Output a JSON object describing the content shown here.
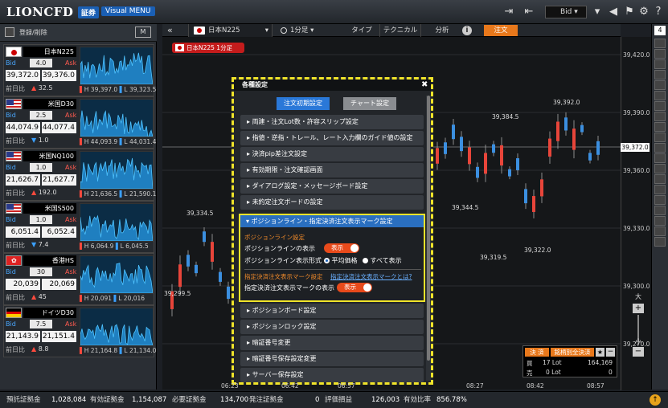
{
  "header": {
    "logo": "LIONCFD",
    "logo_badge": "証券",
    "visual_menu": "Visual MENU",
    "bid_select": "Bid"
  },
  "sidebar": {
    "register_label": "登録/削除",
    "m_label": "M",
    "cards": [
      {
        "name": "日本N225",
        "spread": "4.0",
        "bid": "39,372.0",
        "ask": "39,376.0",
        "change": "32.5",
        "dir": "up",
        "high": "H 39,397.0",
        "low": "L 39,323.5",
        "flag": "jp"
      },
      {
        "name": "米国D30",
        "spread": "2.5",
        "bid": "44,074.9",
        "ask": "44,077.4",
        "change": "1.0",
        "dir": "dn",
        "high": "H 44,093.9",
        "low": "L 44,031.4",
        "flag": "us"
      },
      {
        "name": "米国NQ100",
        "spread": "1.0",
        "bid": "21,626.7",
        "ask": "21,627.7",
        "change": "192.0",
        "dir": "up",
        "high": "H 21,636.5",
        "low": "L 21,590.1",
        "flag": "us"
      },
      {
        "name": "米国S500",
        "spread": "1.0",
        "bid": "6,051.4",
        "ask": "6,052.4",
        "change": "7.4",
        "dir": "dn",
        "high": "H 6,064.9",
        "low": "L 6,045.5",
        "flag": "us"
      },
      {
        "name": "香港HS",
        "spread": "30",
        "bid": "20,039",
        "ask": "20,069",
        "change": "45",
        "dir": "up",
        "high": "H 20,091",
        "low": "L 20,016",
        "flag": "hk"
      },
      {
        "name": "ドイツD30",
        "spread": "7.5",
        "bid": "21,143.9",
        "ask": "21,151.4",
        "change": "8.8",
        "dir": "up",
        "high": "H 21,164.8",
        "low": "L 21,134.0",
        "flag": "de"
      }
    ],
    "bid_label": "Bid",
    "ask_label": "Ask",
    "prev_label": "前日比"
  },
  "toolbar": {
    "symbol": "日本N225",
    "interval": "1分足",
    "type": "タイプ",
    "technical": "テクニカル",
    "analysis": "分析",
    "order": "注文"
  },
  "chart": {
    "symbol_tag": "日本N225 1分足",
    "y_ticks": [
      "39,420.0",
      "39,390.0",
      "39,360.0",
      "39,330.0",
      "39,300.0",
      "39,270.0"
    ],
    "current_price": "39,372.0",
    "x_ticks": [
      "06:23",
      "06:42",
      "06:57",
      "08:27",
      "08:42",
      "08:57"
    ],
    "annotations": [
      "39,334.5",
      "39,299.5",
      "39,392.0",
      "39,384.5",
      "39,344.5",
      "39,319.5",
      "39,322.0"
    ],
    "zoom_plus": "+",
    "zoom_minus": "−",
    "zoom_large": "大",
    "zoom_small": "小"
  },
  "dialog": {
    "title": "各種設定",
    "tab_order": "注文初期設定",
    "tab_chart": "チャート設定",
    "rows_top": [
      "両建・注文Lot数・許容スリップ設定",
      "指値・逆指・トレール、レート入力欄のガイド値の設定",
      "決済pip差注文設定",
      "有効期限・注文確認画面",
      "ダイアログ設定・メッセージボード設定",
      "未約定注文ボードの設定"
    ],
    "expanded_title": "ポジションライン・指定決済注文表示マーク設定",
    "pos_line_section": "ポジションライン設定",
    "pos_line_display": "ポジションラインの表示",
    "toggle_on": "表示",
    "pos_line_format": "ポジションライン表示形式",
    "radio_avg": "平均価格",
    "radio_all": "すべて表示",
    "mark_section": "指定決済注文表示マーク設定",
    "mark_help": "指定決済注文表示マークとは?",
    "mark_display": "指定決済注文表示マークの表示",
    "rows_bottom": [
      "ポジションボード設定",
      "ポジションロック設定",
      "暗証番号変更",
      "暗証番号保存設定変更",
      "サーバー保存設定"
    ]
  },
  "position_panel": {
    "settle": "決 済",
    "settle_all": "銘柄別全決済",
    "buy": "買",
    "buy_lot": "17 Lot",
    "buy_price": "164,169",
    "sell": "売",
    "sell_lot": "0 Lot",
    "sell_price": "0"
  },
  "bottom": {
    "items": [
      {
        "label": "預託証拠金",
        "value": "1,028,084"
      },
      {
        "label": "有効証拠金",
        "value": "1,154,087"
      },
      {
        "label": "必要証拠金",
        "value": "134,700"
      },
      {
        "label": "発注証拠金",
        "value": "0"
      },
      {
        "label": "評価損益",
        "value": "126,003"
      },
      {
        "label": "有効比率",
        "value": "856.78%"
      }
    ]
  },
  "colors": {
    "accent": "#1a5fb4",
    "highlight": "#f0e42a",
    "order": "#e8781b",
    "up": "#e8453a",
    "down": "#3b8fe0"
  }
}
